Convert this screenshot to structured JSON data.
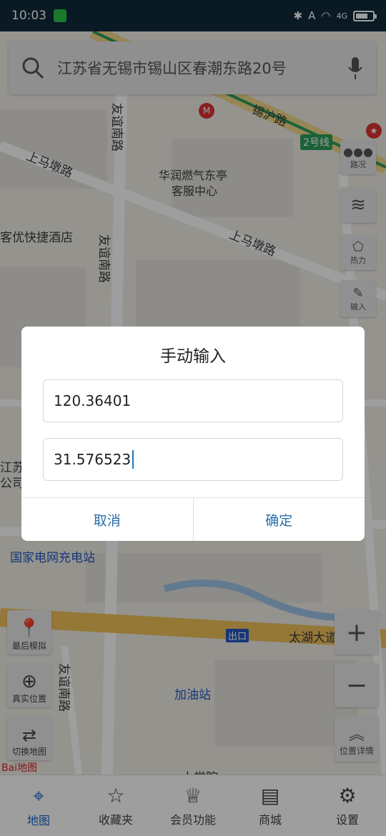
{
  "status": {
    "time": "10:03",
    "network": "4G"
  },
  "search": {
    "address": "江苏省无锡市锡山区春潮东路20号"
  },
  "map_labels": {
    "road_youyi_top": "友谊南路",
    "road_xihu": "锡沪路",
    "line2": "2号线",
    "road_shangmadun_left": "上马墩路",
    "poi_huarun": "华润燃气东亭",
    "poi_huarun2": "客服中心",
    "poi_hotel": "客优快捷酒店",
    "road_youyi_mid": "友谊南路",
    "road_shangmadun_right": "上马墩路",
    "poi_jiangsu": "江苏",
    "poi_company": "公司",
    "poi_charging": "国家电网充电站",
    "road_taihu": "太湖大道",
    "exit_label": "出口",
    "poi_gas": "加油站",
    "road_youyi_bottom": "友谊南路",
    "poi_bottom": "太学院",
    "baidu": "Bai地图"
  },
  "side_buttons": {
    "traffic": "路况",
    "heat": "热力",
    "input": "输入",
    "location_detail": "位置详情"
  },
  "left_buttons": {
    "last_sim": "最后模拟",
    "real_location": "真实位置",
    "switch_map": "切换地图"
  },
  "dialog": {
    "title": "手动输入",
    "longitude": "120.36401",
    "latitude": "31.576523",
    "cancel": "取消",
    "confirm": "确定"
  },
  "bottom_nav": [
    {
      "label": "地图"
    },
    {
      "label": "收藏夹"
    },
    {
      "label": "会员功能"
    },
    {
      "label": "商城"
    },
    {
      "label": "设置"
    }
  ],
  "colors": {
    "accent": "#1a64c8",
    "dialog_button": "#2a6ea8",
    "line2": "#2e9e5b"
  }
}
